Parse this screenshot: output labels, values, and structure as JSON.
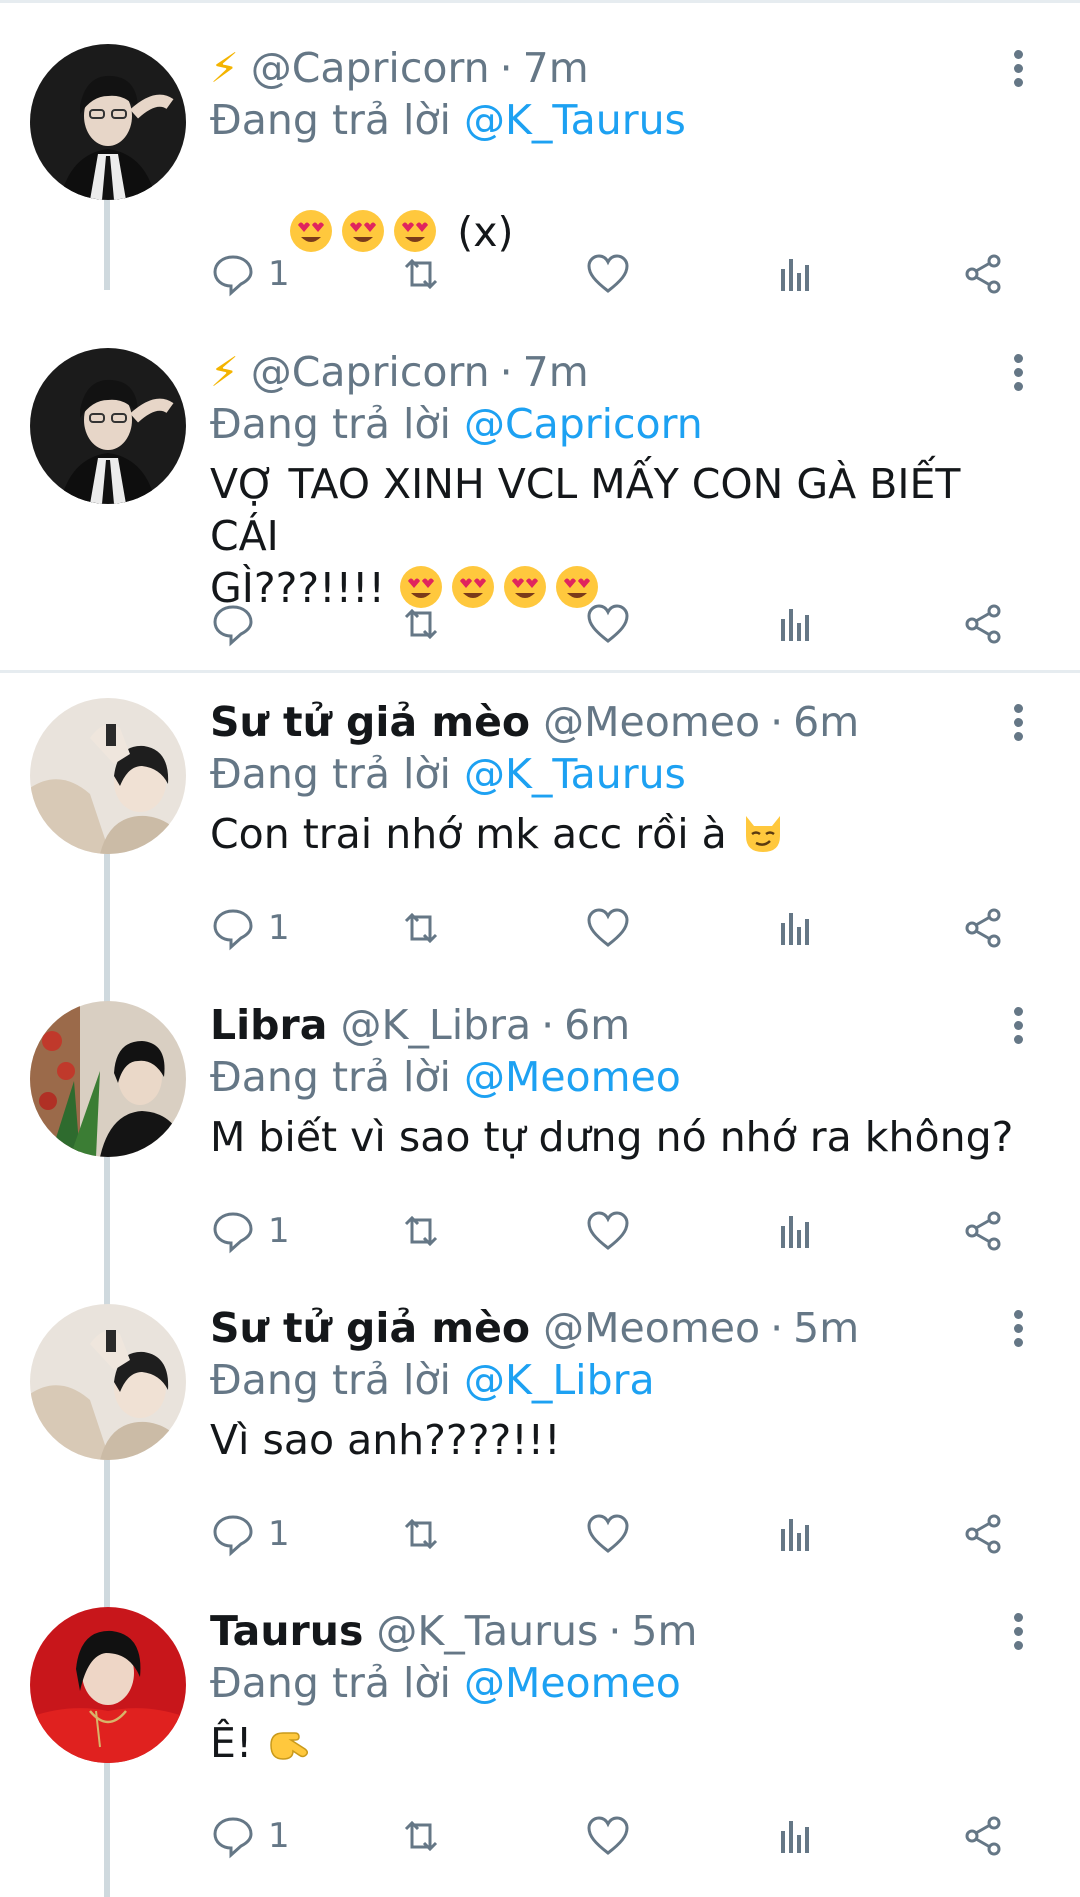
{
  "tweets": [
    {
      "display_name": "",
      "handle": "@Capricorn",
      "time": "7m",
      "reply_prefix": "Đang trả lời",
      "reply_to": "@K_Taurus",
      "text": "(x)",
      "reply_count": "1"
    },
    {
      "display_name": "",
      "handle": "@Capricorn",
      "time": "7m",
      "reply_prefix": "Đang trả lời",
      "reply_to": "@Capricorn",
      "text": "VỢ TAO XINH VCL MẤY CON GÀ BIẾT CÁI\nGÌ???!!!!",
      "reply_count": ""
    },
    {
      "display_name": "Sư tử giả mèo",
      "handle": "@Meomeo",
      "time": "6m",
      "reply_prefix": "Đang trả lời",
      "reply_to": "@K_Taurus",
      "text": "Con trai nhớ mk acc rồi à",
      "reply_count": "1"
    },
    {
      "display_name": "Libra",
      "handle": "@K_Libra",
      "time": "6m",
      "reply_prefix": "Đang trả lời",
      "reply_to": "@Meomeo",
      "text": "M biết vì sao tự dưng nó nhớ ra không?",
      "reply_count": "1"
    },
    {
      "display_name": "Sư tử giả mèo",
      "handle": "@Meomeo",
      "time": "5m",
      "reply_prefix": "Đang trả lời",
      "reply_to": "@K_Libra",
      "text": "Vì sao anh????!!!",
      "reply_count": "1"
    },
    {
      "display_name": "Taurus",
      "handle": "@K_Taurus",
      "time": "5m",
      "reply_prefix": "Đang trả lời",
      "reply_to": "@Meomeo",
      "text": "Ê!",
      "reply_count": "1"
    }
  ],
  "separator": "·",
  "colors": {
    "accent": "#1da1f2",
    "muted": "#657786",
    "text": "#14171a"
  },
  "icons": {
    "capricorn_badge": "lightning-icon",
    "action_reply": "speech-bubble-icon",
    "action_retweet": "retweet-icon",
    "action_like": "heart-icon",
    "action_stats": "bar-chart-icon",
    "action_share": "share-icon",
    "more": "vertical-dots-icon"
  }
}
